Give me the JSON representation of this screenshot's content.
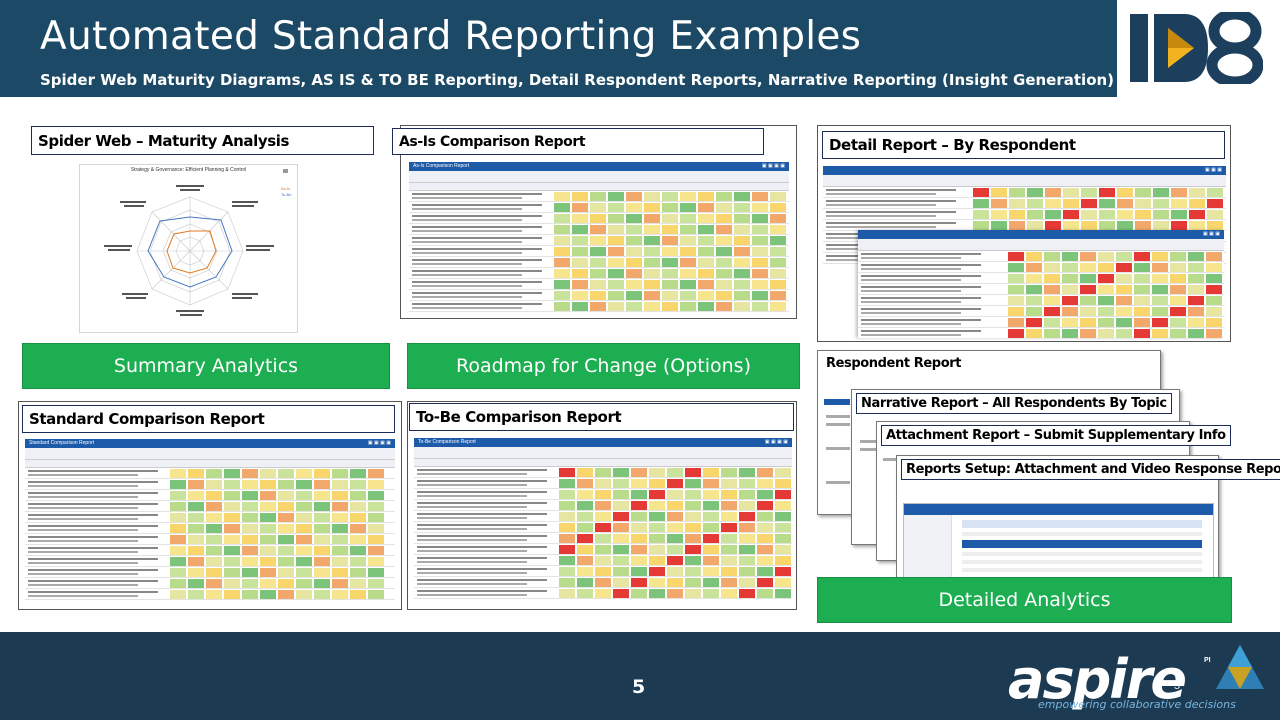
{
  "header": {
    "title": "Automated Standard Reporting Examples",
    "subtitle": "Spider Web Maturity Diagrams, AS IS & TO BE Reporting, Detail Respondent Reports, Narrative Reporting (Insight Generation)"
  },
  "logo": {
    "id8_text": "ID8"
  },
  "sections": {
    "spider_label": "Spider Web – Maturity Analysis",
    "spider_title": "Strategy & Governance: Efficient Planning & Control",
    "spider_legend": [
      "As-Is",
      "To-Be"
    ],
    "asis_label": "As-Is Comparison Report",
    "asis_bar": "As-Is Comparison Report",
    "detail_label": "Detail Report – By Respondent",
    "standard_label": "Standard Comparison Report",
    "standard_bar": "Standard Comparison Report",
    "tobe_label": "To-Be Comparison Report",
    "tobe_bar": "To-Be Comparison Report",
    "respondent_label": "Respondent Report",
    "narrative_label": "Narrative Report – All Respondents By Topic",
    "attachment_label": "Attachment Report – Submit Supplementary Info",
    "setup_label": "Reports Setup: Attachment and Video Response Report"
  },
  "buttons": {
    "summary": "Summary Analytics",
    "roadmap": "Roadmap for Change (Options)",
    "detailed": "Detailed Analytics"
  },
  "footer": {
    "page_number": "5",
    "page_number_small": "5",
    "brand": "aspire",
    "brand_sup": "PI",
    "tagline": "empowering collaborative decisions"
  },
  "colors": {
    "header_bg": "#1c4a66",
    "footer_bg": "#1c3a52",
    "green_button": "#1dae52",
    "report_bar": "#1d5aa8",
    "id8_navy": "#1c3f5e",
    "id8_gold": "#f2b320"
  }
}
